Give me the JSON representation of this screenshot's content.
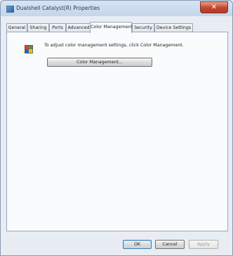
{
  "window": {
    "title": "Dualshell Catalyst(R) Properties",
    "close_glyph": "✕"
  },
  "tabs": [
    {
      "label": "General"
    },
    {
      "label": "Sharing"
    },
    {
      "label": "Ports"
    },
    {
      "label": "Advanced"
    },
    {
      "label": "Color Management",
      "active": true
    },
    {
      "label": "Security"
    },
    {
      "label": "Device Settings"
    }
  ],
  "color_management": {
    "description": "To adjust color management settings, click Color Management.",
    "button_label": "Color Management...",
    "icon": "color-management-icon"
  },
  "footer": {
    "ok_label": "OK",
    "cancel_label": "Cancel",
    "apply_label": "Apply"
  }
}
